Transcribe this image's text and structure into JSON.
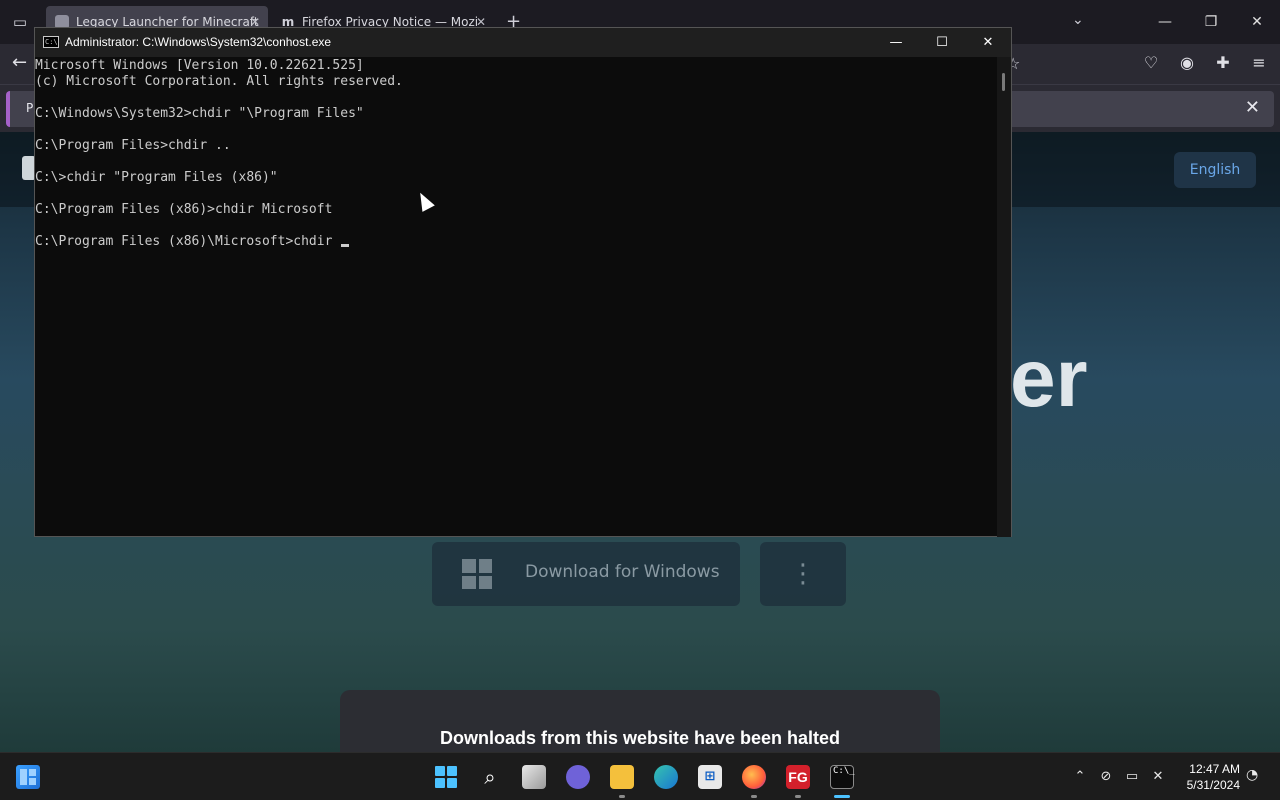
{
  "firefox": {
    "tabs": [
      {
        "title": "Legacy Launcher for Minecraft",
        "active": true
      },
      {
        "title": "Firefox Privacy Notice — Mozi",
        "active": false
      }
    ],
    "tab_close": "✕",
    "new_tab": "+",
    "notice_text": "Pl",
    "notice_close": "✕",
    "language_button": "English",
    "hero_fragment": "er",
    "download_label": "Download for Windows",
    "more_button": "⋮",
    "halt_message": "Downloads from this website have been halted",
    "accent_color": "#a561c9"
  },
  "console": {
    "title": "Administrator: C:\\Windows\\System32\\conhost.exe",
    "icon_text": "C:\\",
    "lines": [
      "Microsoft Windows [Version 10.0.22621.525]",
      "(c) Microsoft Corporation. All rights reserved.",
      "",
      "C:\\Windows\\System32>chdir \"\\Program Files\"",
      "",
      "C:\\Program Files>chdir ..",
      "",
      "C:\\>chdir \"Program Files (x86)\"",
      "",
      "C:\\Program Files (x86)>chdir Microsoft",
      "",
      "C:\\Program Files (x86)\\Microsoft>chdir "
    ],
    "text_color": "#cccccc",
    "background_color": "#0c0c0c"
  },
  "taskbar": {
    "apps": [
      {
        "name": "start",
        "label": "",
        "indicator": "none"
      },
      {
        "name": "search",
        "label": "⌕",
        "indicator": "none"
      },
      {
        "name": "task-view",
        "label": "",
        "indicator": "none"
      },
      {
        "name": "chat",
        "label": "",
        "indicator": "none"
      },
      {
        "name": "file-explorer",
        "label": "",
        "indicator": "open"
      },
      {
        "name": "edge",
        "label": "",
        "indicator": "none"
      },
      {
        "name": "store",
        "label": "⊞",
        "indicator": "none"
      },
      {
        "name": "firefox",
        "label": "",
        "indicator": "open"
      },
      {
        "name": "fg",
        "label": "FG",
        "indicator": "open"
      },
      {
        "name": "console",
        "label": "C:\\_",
        "indicator": "active"
      }
    ],
    "clock_time": "12:47 AM",
    "clock_date": "5/31/2024"
  }
}
